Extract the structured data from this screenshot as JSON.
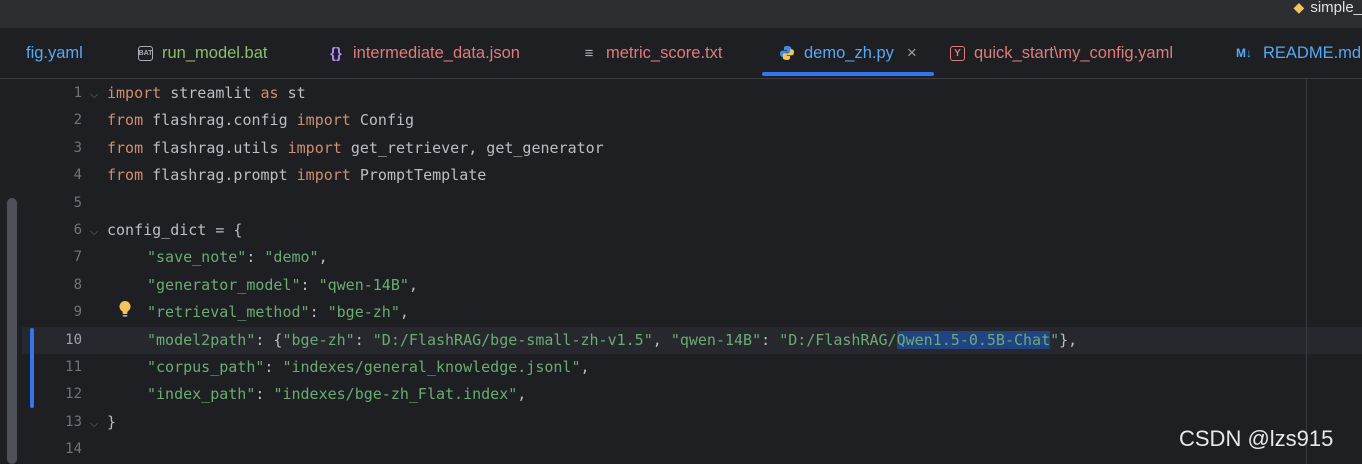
{
  "topbar": {
    "run_config_label": "simple_"
  },
  "tabs": [
    {
      "label": "fig.yaml",
      "icon": "yaml-icon",
      "color": "#56a8f5"
    },
    {
      "label": "run_model.bat",
      "icon": "bat-file-icon",
      "color": "#8bbf6a"
    },
    {
      "label": "intermediate_data.json",
      "icon": "json-braces-icon",
      "color": "#e07b7b"
    },
    {
      "label": "metric_score.txt",
      "icon": "text-file-icon",
      "color": "#e07b7b"
    },
    {
      "label": "demo_zh.py",
      "icon": "python-icon",
      "color": "#56a8f5",
      "active": true
    },
    {
      "label": "quick_start\\my_config.yaml",
      "icon": "yaml-file-icon",
      "color": "#e07b7b"
    },
    {
      "label": "README.md",
      "icon": "markdown-icon",
      "color": "#56a8f5"
    }
  ],
  "line_numbers": [
    "1",
    "2",
    "3",
    "4",
    "5",
    "6",
    "7",
    "8",
    "9",
    "10",
    "11",
    "12",
    "13",
    "14"
  ],
  "code": {
    "l1": {
      "kw1": "import",
      "t1": " streamlit ",
      "kw2": "as",
      "t2": " st"
    },
    "l2": {
      "kw1": "from",
      "t1": " flashrag.config ",
      "kw2": "import",
      "t2": " Config"
    },
    "l3": {
      "kw1": "from",
      "t1": " flashrag.utils ",
      "kw2": "import",
      "t2": " get_retriever, get_generator"
    },
    "l4": {
      "kw1": "from",
      "t1": " flashrag.prompt ",
      "kw2": "import",
      "t2": " PromptTemplate"
    },
    "l6": "config_dict = {",
    "l7": {
      "k": "\"save_note\"",
      "sep": ": ",
      "v": "\"demo\"",
      "end": ","
    },
    "l8": {
      "k": "\"generator_model\"",
      "sep": ": ",
      "v": "\"qwen-14B\"",
      "end": ","
    },
    "l9": {
      "k": "\"retrieval_method\"",
      "sep": ": ",
      "v": "\"bge-zh\"",
      "end": ","
    },
    "l10": {
      "k": "\"model2path\"",
      "sep": ": {",
      "k2": "\"bge-zh\"",
      "sep2": ": ",
      "v2": "\"D:/FlashRAG/bge-small-zh-v1.5\"",
      "sep3": ", ",
      "k3": "\"qwen-14B\"",
      "sep4": ": ",
      "v3a": "\"D:/FlashRAG/",
      "v3sel": "Qwen1.5-0.5B-Chat",
      "v3b": "\"",
      "end": "},"
    },
    "l11": {
      "k": "\"corpus_path\"",
      "sep": ": ",
      "v": "\"indexes/general_knowledge.jsonl\"",
      "end": ","
    },
    "l12": {
      "k": "\"index_path\"",
      "sep": ": ",
      "v": "\"indexes/bge-zh_Flat.index\"",
      "end": ","
    },
    "l13": "}"
  },
  "watermark": "CSDN @lzs915",
  "colors": {
    "keyword": "#cf8e6d",
    "string": "#6aab73",
    "accent": "#3574f0",
    "background": "#1e1f22"
  }
}
